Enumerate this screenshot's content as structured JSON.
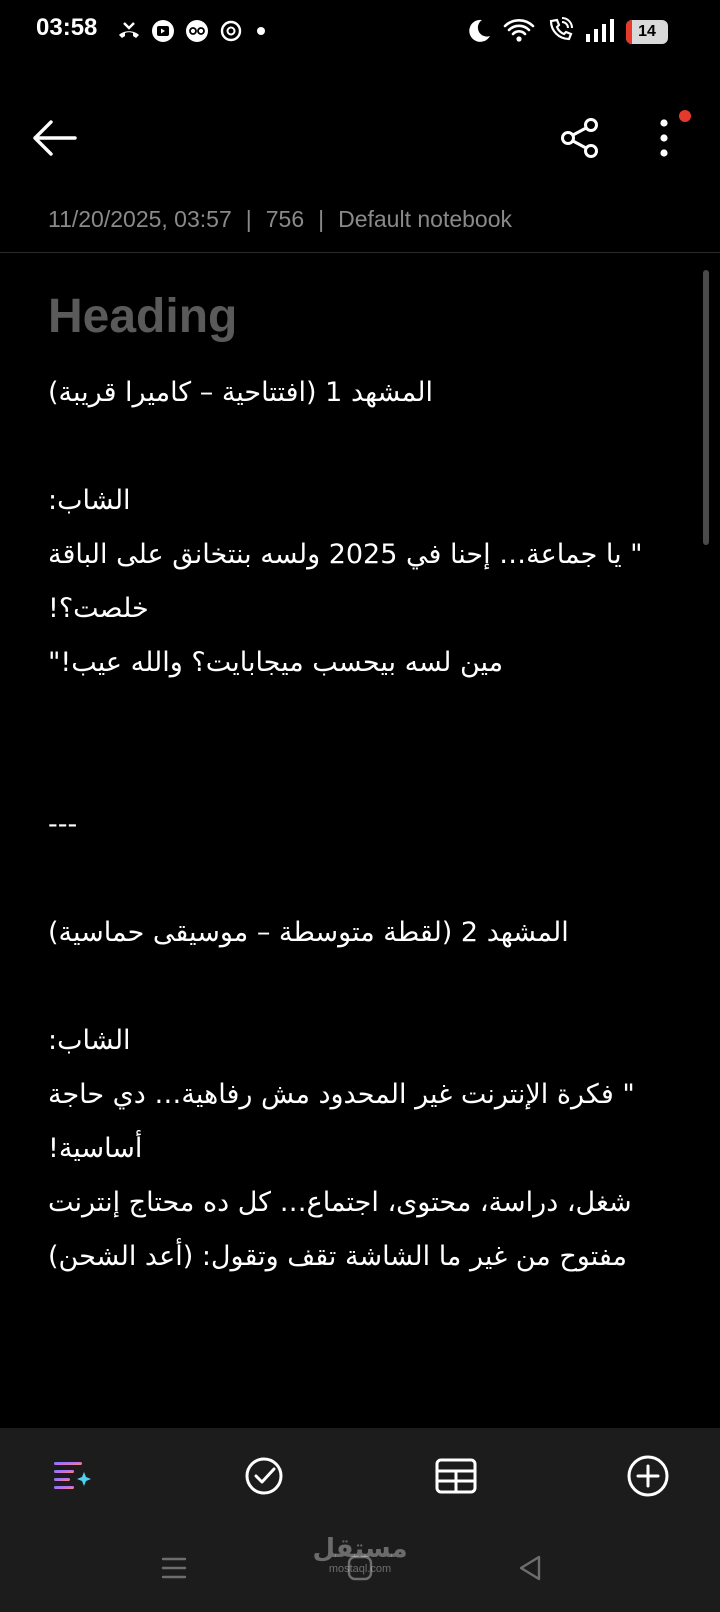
{
  "status_bar": {
    "time": "03:58",
    "battery_level": "14",
    "battery_fraction": 0.14,
    "left_icons": [
      "missed-call-icon",
      "media-icon",
      "app-icon",
      "threads-icon",
      "dot-icon"
    ],
    "right_icons": [
      "moon-icon",
      "wifi-icon",
      "wifi-calling-icon",
      "signal-icon",
      "battery-icon"
    ]
  },
  "toolbar": {
    "back_icon": "back-arrow-icon",
    "share_icon": "share-icon",
    "more_icon": "more-vertical-icon",
    "notification_color": "#e5392c"
  },
  "meta": {
    "datetime": "11/20/2025, 03:57",
    "sep1": "|",
    "count": "756",
    "sep2": "|",
    "notebook": "Default notebook"
  },
  "note": {
    "heading_placeholder": "Heading",
    "lines": [
      "المشهد 1 (افتتاحية – كاميرا قريبة)",
      "",
      "الشاب:",
      "\" يا جماعة… إحنا في 2025 ولسه بنتخانق على الباقة",
      "خلصت؟!",
      "مين لسه بيحسب ميجابايت؟ والله عيب!\"",
      "",
      "",
      "---",
      "",
      " المشهد 2 (لقطة متوسطة – موسيقى حماسية)",
      "",
      "الشاب:",
      "\" فكرة الإنترنت غير المحدود مش رفاهية… دي حاجة",
      "أساسية!",
      " شغل، دراسة، محتوى، اجتماع… كل ده محتاج إنترنت",
      "مفتوح من غير ما الشاشة تقف وتقول: (أعد الشحن)"
    ]
  },
  "bottom_toolbar": {
    "icons": [
      "ai-text-icon",
      "checklist-icon",
      "table-icon",
      "add-icon"
    ]
  },
  "nav_bar": {
    "icons": [
      "recent-apps-icon",
      "home-icon",
      "back-nav-icon"
    ]
  },
  "watermark": {
    "arabic": "مستقل",
    "latin": "mostaql.com"
  }
}
